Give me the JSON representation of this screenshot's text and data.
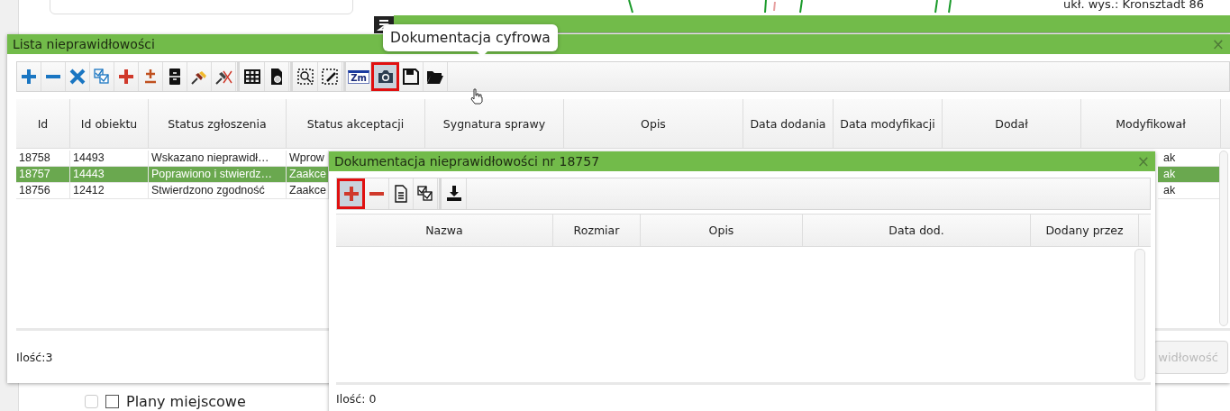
{
  "map_label": "ukł. wys.: Kronsztadt 86",
  "tooltip": "Dokumentacja cyfrowa",
  "layer_item": {
    "label": "Plany miejscowe",
    "selected": false,
    "checked": false
  },
  "main_window": {
    "title": "Lista nieprawidłowości",
    "close": "×",
    "toolbar": [
      [
        {
          "kind": "add",
          "highlighted": false
        },
        {
          "kind": "remove",
          "highlighted": false
        },
        {
          "kind": "delete",
          "highlighted": false
        },
        {
          "kind": "checklist",
          "highlighted": false
        },
        {
          "kind": "add-alt",
          "highlighted": false
        },
        {
          "kind": "plusminus",
          "highlighted": false
        },
        {
          "kind": "cabinet",
          "highlighted": false
        },
        {
          "kind": "pins",
          "highlighted": false
        },
        {
          "kind": "unpin",
          "highlighted": false
        }
      ],
      [
        {
          "kind": "table",
          "highlighted": false
        },
        {
          "kind": "doc-search",
          "highlighted": false
        }
      ],
      [
        {
          "kind": "zoom-select",
          "highlighted": false
        },
        {
          "kind": "edit-select",
          "highlighted": false
        }
      ],
      [
        {
          "kind": "zm",
          "label": "Zm",
          "highlighted": false
        },
        {
          "kind": "camera",
          "highlighted": true
        },
        {
          "kind": "save",
          "highlighted": false
        },
        {
          "kind": "folder",
          "highlighted": false
        }
      ]
    ],
    "columns": [
      "Id",
      "Id obiektu",
      "Status zgłoszenia",
      "Status akceptacji",
      "Sygnatura sprawy",
      "Opis",
      "Data dodania",
      "Data modyfikacji",
      "Dodał",
      "Modyfikował"
    ],
    "rows": [
      {
        "cells": [
          "18758",
          "14493",
          "Wskazano nieprawidł…",
          "Wprow"
        ],
        "modified_by": "ak",
        "selected": false
      },
      {
        "cells": [
          "18757",
          "14443",
          "Poprawiono i stwierdz…",
          "Zaakce"
        ],
        "modified_by": "ak",
        "selected": true
      },
      {
        "cells": [
          "18756",
          "12412",
          "Stwierdzono zgodność",
          "Zaakce"
        ],
        "modified_by": "ak",
        "selected": false
      }
    ],
    "count": "Ilość:3",
    "button": {
      "label": "widłowość",
      "disabled": true
    }
  },
  "dialog": {
    "title": "Dokumentacja nieprawidłowości nr 18757",
    "close": "×",
    "toolbar": [
      [
        {
          "kind": "add-alt",
          "highlighted": true
        },
        {
          "kind": "remove-alt",
          "highlighted": false
        },
        {
          "kind": "document",
          "highlighted": false
        },
        {
          "kind": "checklist-plain",
          "highlighted": false
        }
      ],
      [
        {
          "kind": "download",
          "highlighted": false
        }
      ]
    ],
    "columns": [
      "Nazwa",
      "Rozmiar",
      "Opis",
      "Data dod.",
      "Dodany przez"
    ],
    "count": "Ilość: 0"
  }
}
